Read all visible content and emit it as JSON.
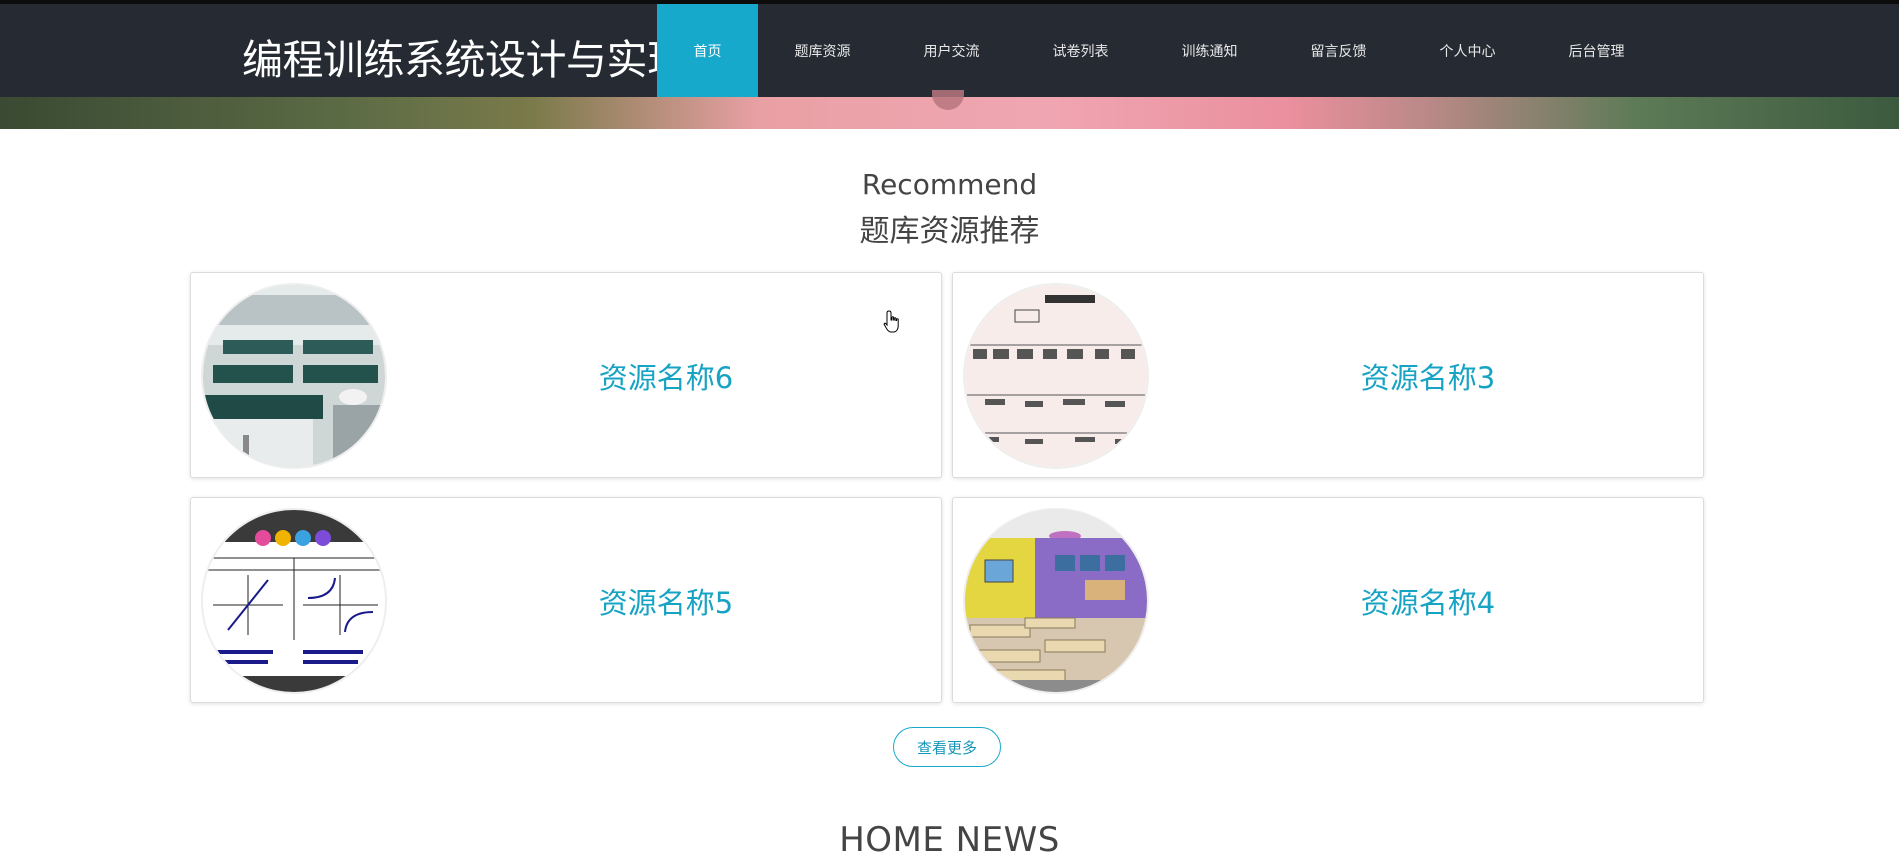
{
  "header": {
    "site_title": "编程训练系统设计与实现",
    "nav": [
      {
        "label": "首页",
        "active": true
      },
      {
        "label": "题库资源"
      },
      {
        "label": "用户交流"
      },
      {
        "label": "试卷列表"
      },
      {
        "label": "训练通知"
      },
      {
        "label": "留言反馈"
      },
      {
        "label": "个人中心"
      },
      {
        "label": "后台管理"
      }
    ]
  },
  "recommend": {
    "title_en": "Recommend",
    "title_cn": "题库资源推荐",
    "items": [
      {
        "name": "资源名称6",
        "image": "lab-classroom-photo"
      },
      {
        "name": "资源名称3",
        "image": "history-timeline-chart"
      },
      {
        "name": "资源名称5",
        "image": "math-function-graphs"
      },
      {
        "name": "资源名称4",
        "image": "colorful-classroom-photo"
      }
    ],
    "more_label": "查看更多"
  },
  "news": {
    "title": "HOME NEWS"
  },
  "colors": {
    "accent": "#17a9cc",
    "topbar": "#262b33",
    "card_text": "#17a3c3"
  }
}
